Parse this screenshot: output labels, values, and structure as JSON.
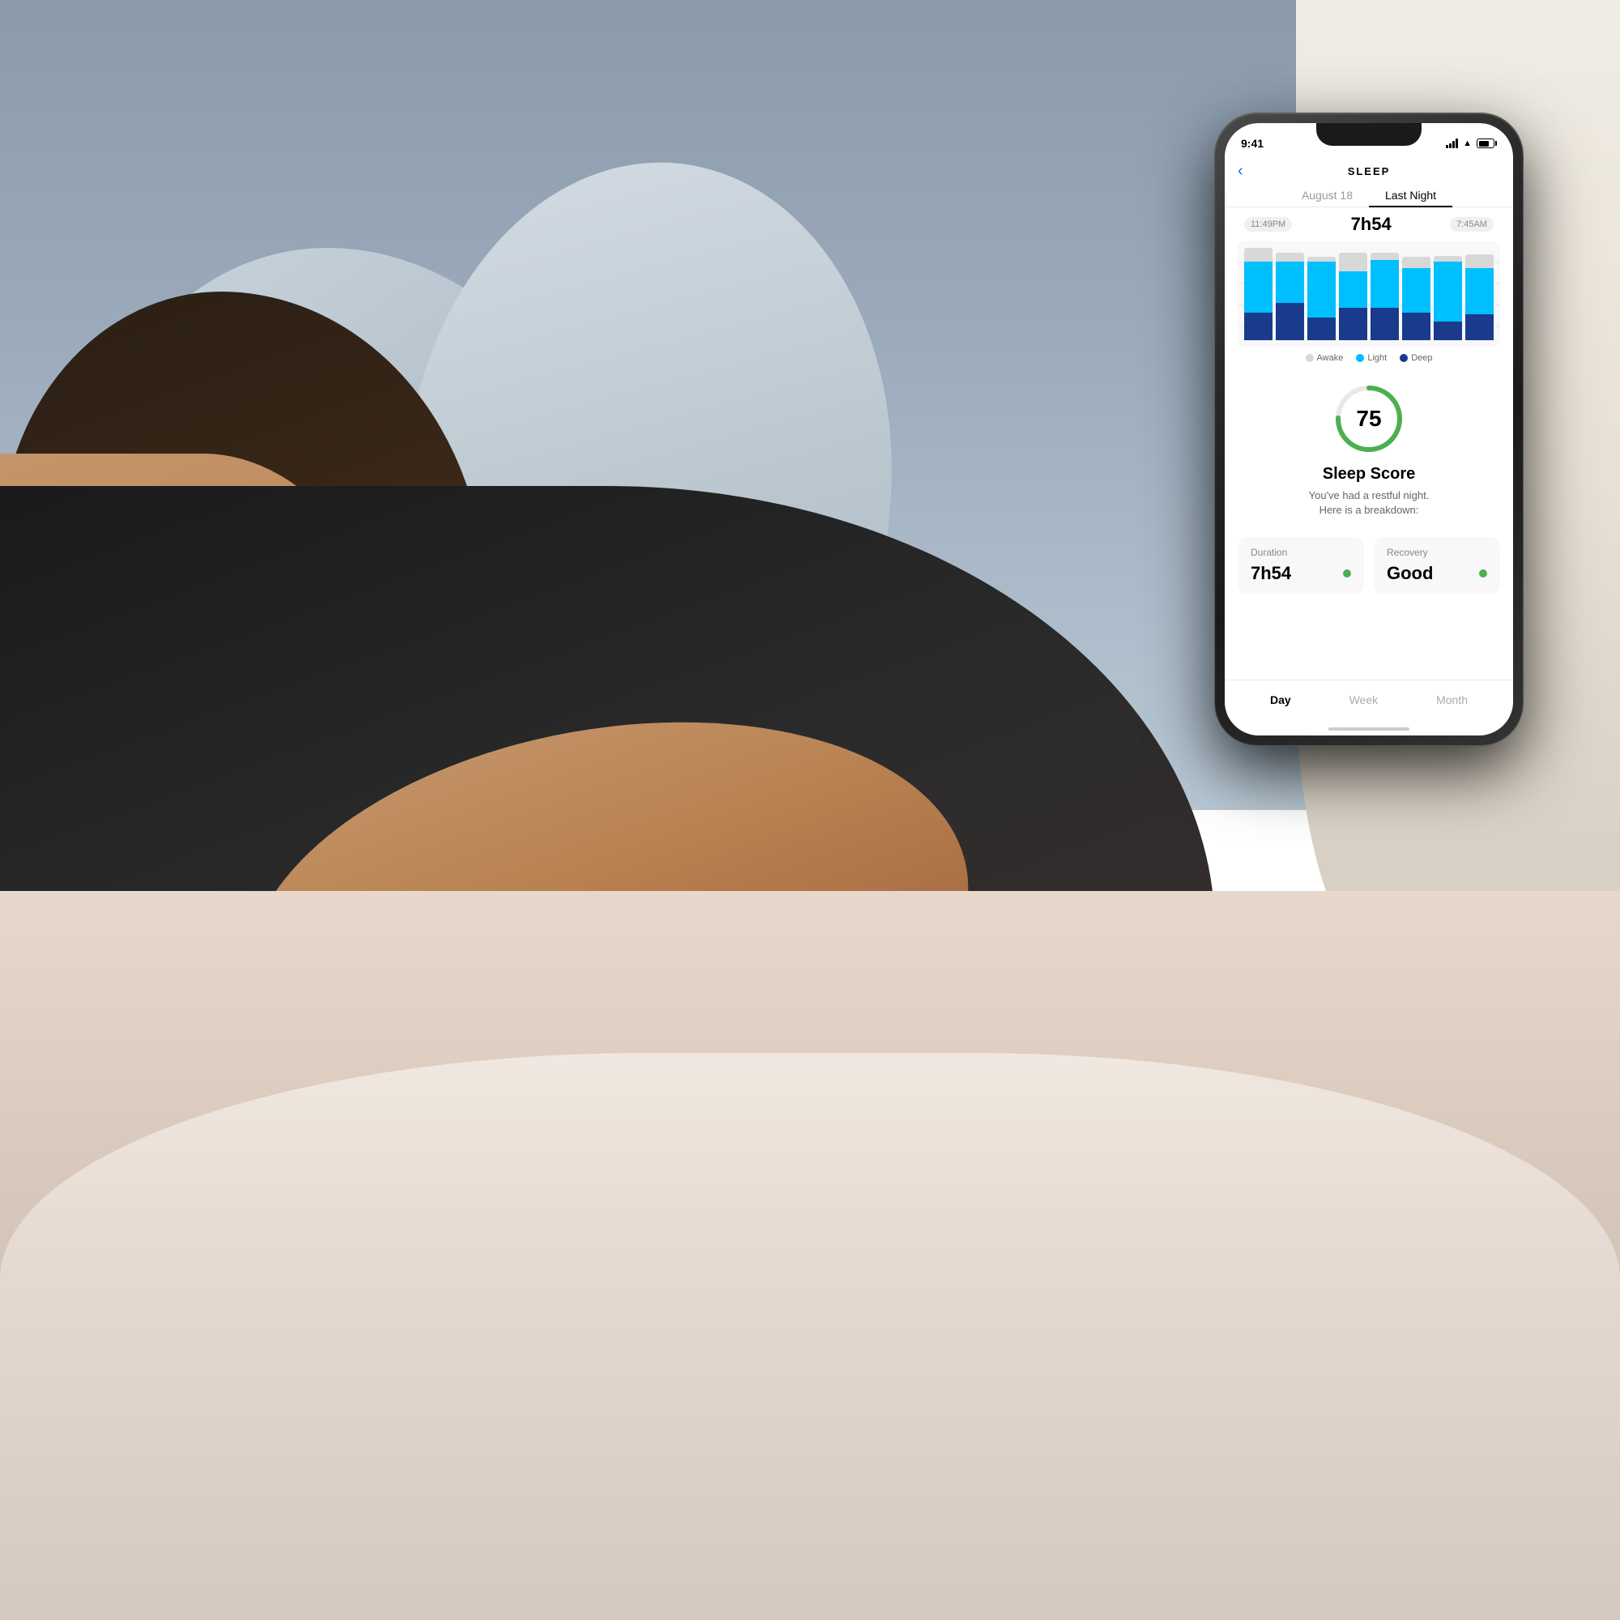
{
  "background": {
    "description": "Woman sleeping in bed with watch"
  },
  "status_bar": {
    "time": "9:41",
    "signal_label": "signal",
    "wifi_label": "wifi",
    "battery_label": "battery"
  },
  "nav": {
    "back_label": "‹",
    "title": "SLEEP"
  },
  "date_tabs": [
    {
      "label": "August 18",
      "active": false
    },
    {
      "label": "Last Night",
      "active": true
    }
  ],
  "time_range": {
    "start": "11:49PM",
    "duration": "7h54",
    "end": "7:45AM"
  },
  "chart": {
    "legend": [
      {
        "label": "Awake",
        "color": "#d8d8d8"
      },
      {
        "label": "Light",
        "color": "#00BFFF"
      },
      {
        "label": "Deep",
        "color": "#1a3a8c"
      }
    ],
    "bars": [
      {
        "awake": 15,
        "light": 55,
        "deep": 30
      },
      {
        "awake": 10,
        "light": 45,
        "deep": 40
      },
      {
        "awake": 5,
        "light": 60,
        "deep": 25
      },
      {
        "awake": 20,
        "light": 40,
        "deep": 35
      },
      {
        "awake": 8,
        "light": 52,
        "deep": 35
      },
      {
        "awake": 12,
        "light": 48,
        "deep": 30
      },
      {
        "awake": 6,
        "light": 65,
        "deep": 20
      },
      {
        "awake": 15,
        "light": 50,
        "deep": 28
      }
    ]
  },
  "sleep_score": {
    "value": 75,
    "label": "Sleep Score",
    "description": "You've had a restful night.\nHere is a breakdown:",
    "arc_color": "#4CAF50",
    "arc_bg_color": "#e8e8e8"
  },
  "metrics": [
    {
      "label": "Duration",
      "value": "7h54",
      "dot_color": "#4CAF50"
    },
    {
      "label": "Recovery",
      "value": "Good",
      "dot_color": "#4CAF50"
    }
  ],
  "bottom_tabs": [
    {
      "label": "Day",
      "active": true
    },
    {
      "label": "Week",
      "active": false
    },
    {
      "label": "Month",
      "active": false
    }
  ]
}
